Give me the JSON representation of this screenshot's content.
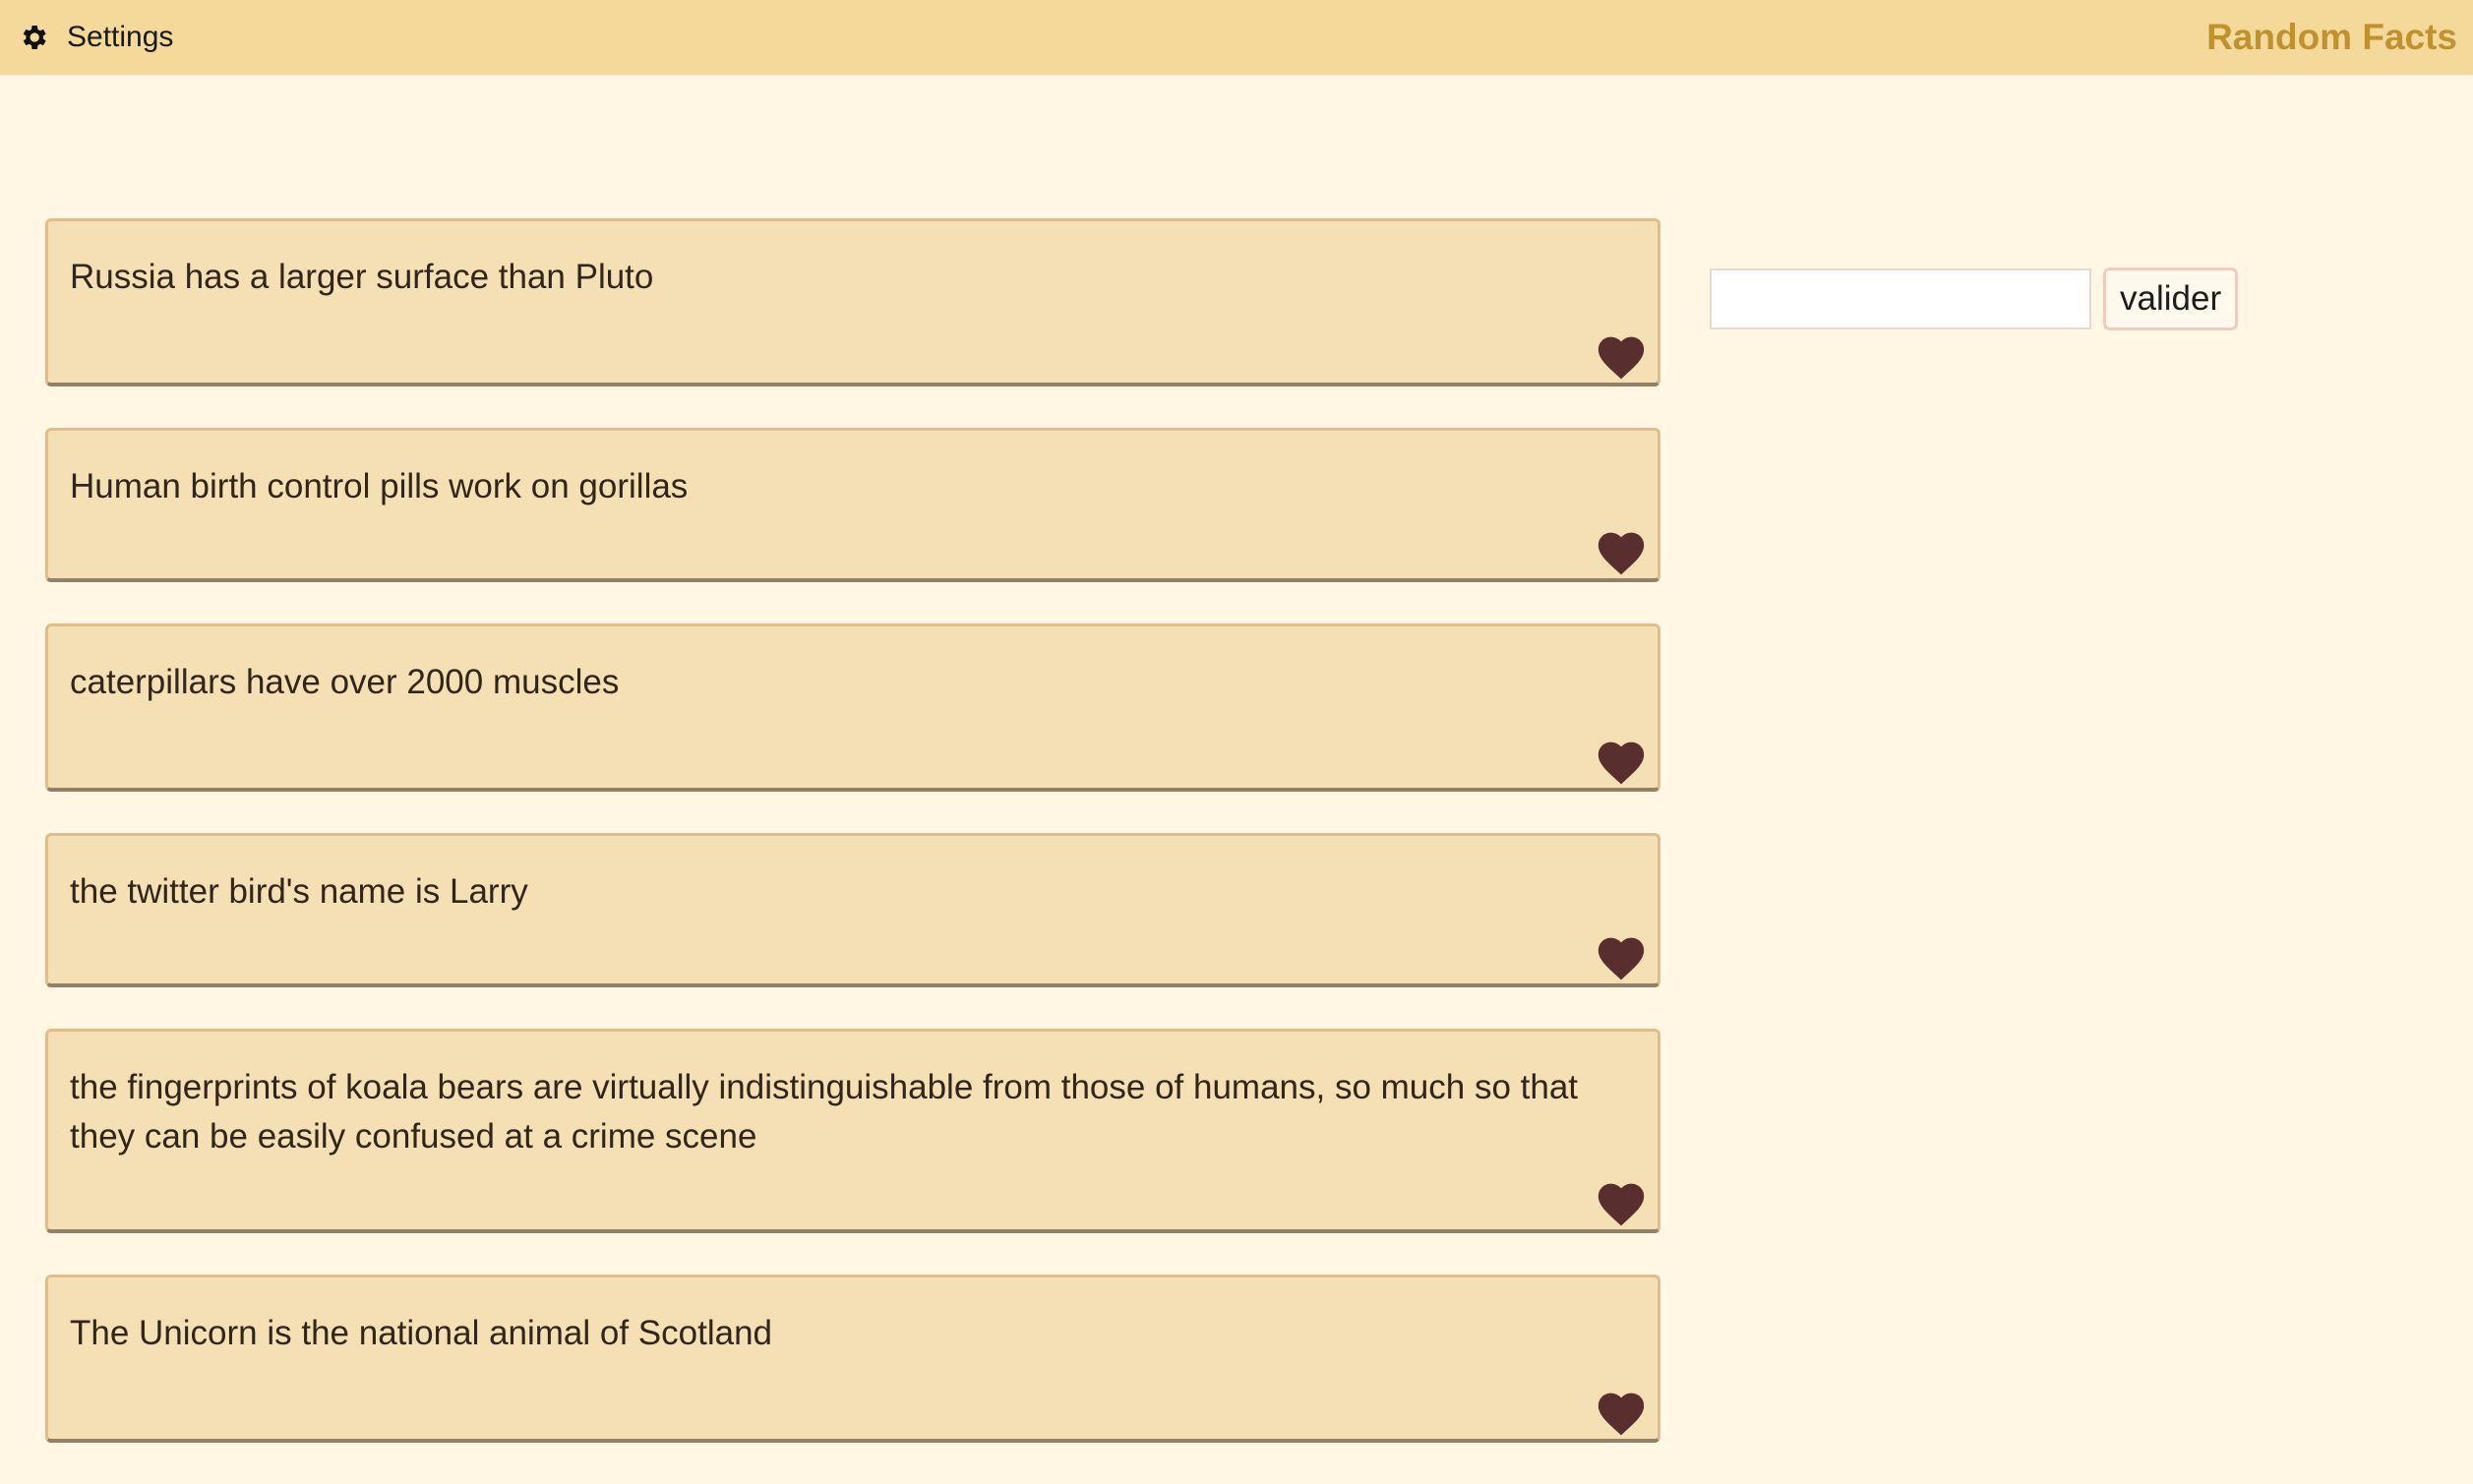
{
  "header": {
    "settings_label": "Settings",
    "settings_icon": "gear-icon",
    "brand": "Random Facts"
  },
  "facts": [
    {
      "text": "Russia has a larger surface than Pluto"
    },
    {
      "text": "Human birth control pills work on gorillas"
    },
    {
      "text": "caterpillars have over 2000 muscles"
    },
    {
      "text": "the twitter bird's name is Larry"
    },
    {
      "text": "the fingerprints of koala bears are virtually indistinguishable from those of humans, so much so that they can be easily confused at a crime scene"
    },
    {
      "text": "The Unicorn is the national animal of Scotland"
    }
  ],
  "form": {
    "input_value": "",
    "submit_label": "valider"
  },
  "colors": {
    "header_bg": "#f5d99b",
    "page_bg": "#fff6e4",
    "card_bg": "#f5dfb4",
    "brand": "#bf922f",
    "heart": "#582e2e"
  }
}
